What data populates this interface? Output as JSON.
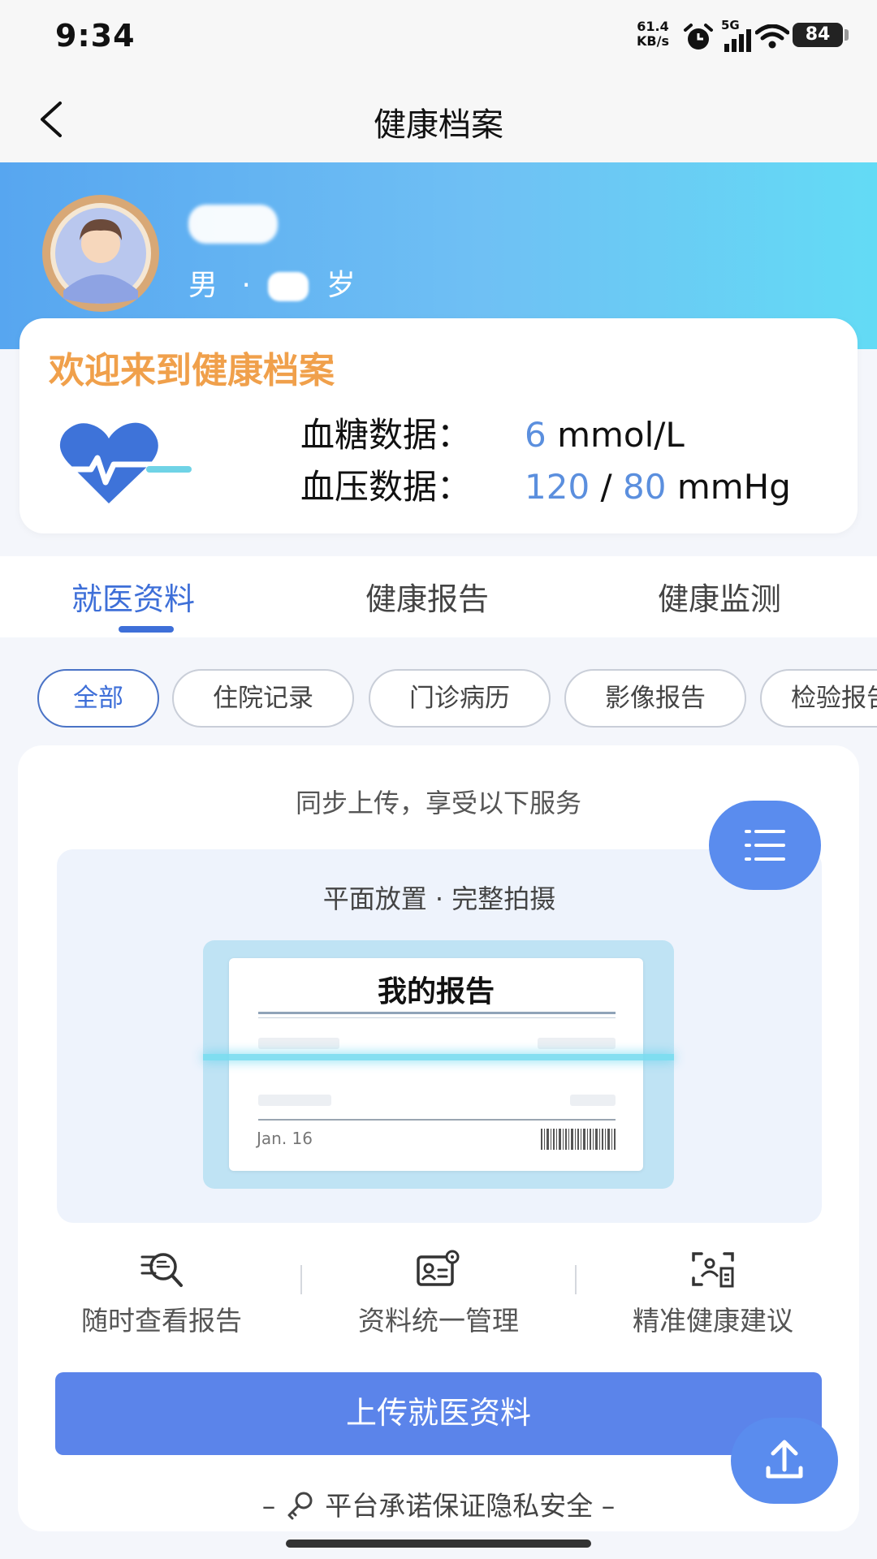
{
  "status_bar": {
    "time": "9:34",
    "net_speed_value": "61.4",
    "net_speed_unit": "KB/s",
    "network": "5G",
    "battery": "84"
  },
  "nav": {
    "title": "健康档案"
  },
  "profile": {
    "gender": "男",
    "separator": "·",
    "age_unit": "岁"
  },
  "welcome": {
    "title": "欢迎来到健康档案",
    "glucose_label": "血糖数据：",
    "glucose_value": "6",
    "glucose_unit": "mmol/L",
    "bp_label": "血压数据：",
    "bp_systolic": "120",
    "bp_sep": "/",
    "bp_diastolic": "80",
    "bp_unit": "mmHg"
  },
  "tabs": [
    {
      "label": "就医资料",
      "active": true
    },
    {
      "label": "健康报告",
      "active": false
    },
    {
      "label": "健康监测",
      "active": false
    }
  ],
  "chips": [
    {
      "label": "全部",
      "active": true
    },
    {
      "label": "住院记录",
      "active": false
    },
    {
      "label": "门诊病历",
      "active": false
    },
    {
      "label": "影像报告",
      "active": false
    },
    {
      "label": "检验报告",
      "active": false
    }
  ],
  "upload_card": {
    "sync_text": "同步上传，享受以下服务",
    "photo_hint": "平面放置 · 完整拍摄",
    "sample_title": "我的报告",
    "sample_date": "Jan. 16",
    "features": [
      {
        "label": "随时查看报告",
        "icon": "search-report-icon"
      },
      {
        "label": "资料统一管理",
        "icon": "id-card-gear-icon"
      },
      {
        "label": "精准健康建议",
        "icon": "scan-advice-icon"
      }
    ],
    "upload_button": "上传就医资料",
    "privacy_text": "平台承诺保证隐私安全"
  },
  "colors": {
    "accent": "#3e6fd8",
    "button": "#5b84ea",
    "welcome_title": "#f0a04b",
    "value": "#5b8fde"
  }
}
